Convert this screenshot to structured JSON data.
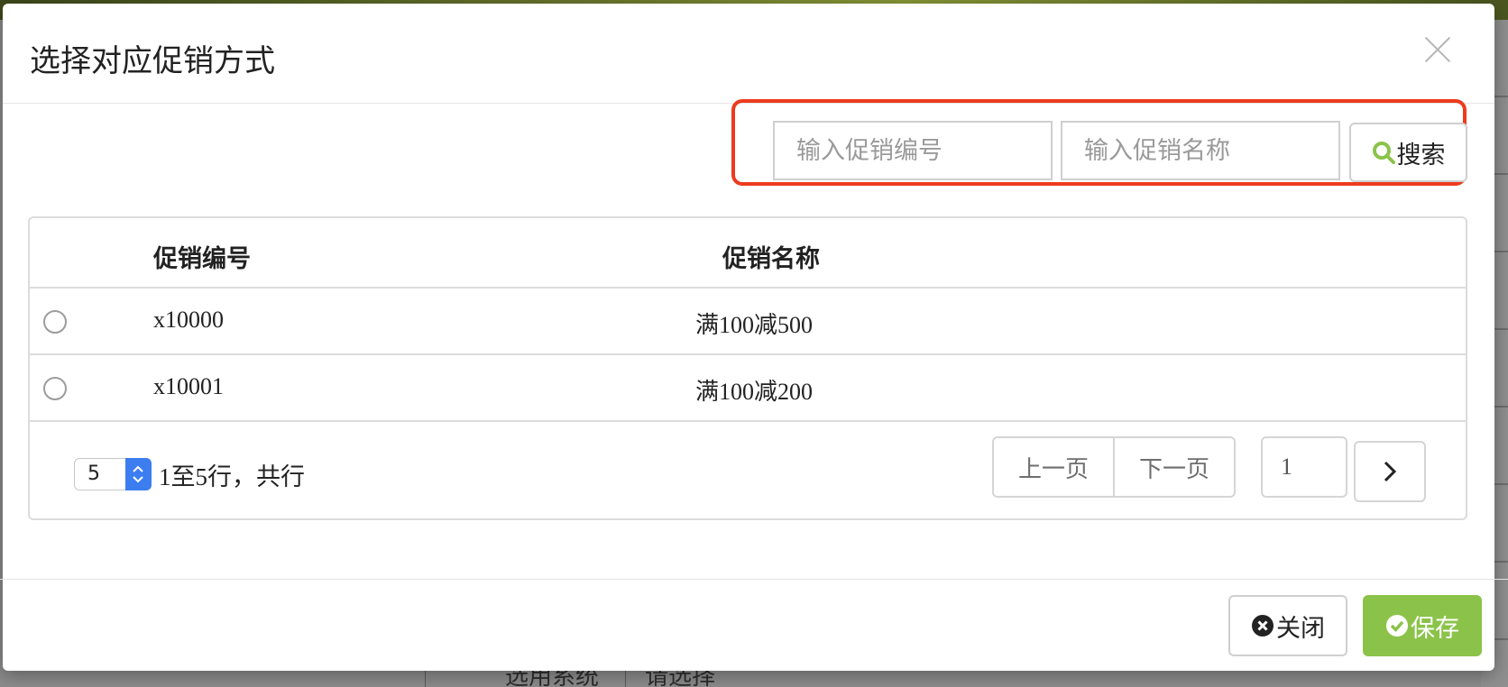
{
  "dialog": {
    "title": "选择对应促销方式"
  },
  "search": {
    "code_placeholder": "输入促销编号",
    "name_placeholder": "输入促销名称",
    "button_label": "搜索"
  },
  "table": {
    "columns": [
      "促销编号",
      "促销名称"
    ],
    "rows": [
      {
        "code": "x10000",
        "name": "满100减500"
      },
      {
        "code": "x10001",
        "name": "满100减200"
      }
    ]
  },
  "pagination": {
    "page_size": "5",
    "info": "1至5行，共行",
    "prev_label": "上一页",
    "next_label": "下一页",
    "current_page": "1"
  },
  "footer": {
    "close_label": "关闭",
    "save_label": "保存"
  },
  "background": {
    "fragments": [
      "选用系统",
      "请选择"
    ]
  },
  "colors": {
    "highlight_border": "#ec3b1d",
    "save_button": "#8bc34a",
    "search_icon": "#8bc34a",
    "select_arrow": "#3c7df0"
  },
  "icons": {
    "search": "search-icon",
    "close": "close-icon",
    "save": "check-circle-icon",
    "close_dialog": "x-icon",
    "next": "chevron-right-icon"
  }
}
